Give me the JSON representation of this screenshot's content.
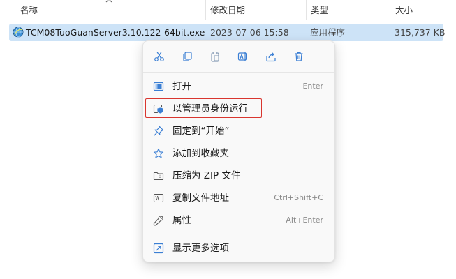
{
  "columns": {
    "name": "名称",
    "modified": "修改日期",
    "type": "类型",
    "size": "大小"
  },
  "file": {
    "name": "TCM08TuoGuanServer3.10.122-64bit.exe",
    "modified": "2023-07-06 15:58",
    "type": "应用程序",
    "size": "315,737 KB",
    "icon": "app-globe-icon"
  },
  "quick_actions": [
    {
      "icon": "cut-icon"
    },
    {
      "icon": "copy-icon"
    },
    {
      "icon": "paste-icon"
    },
    {
      "icon": "rename-icon"
    },
    {
      "icon": "share-icon"
    },
    {
      "icon": "delete-icon"
    }
  ],
  "menu": {
    "open": {
      "label": "打开",
      "shortcut": "Enter",
      "icon": "open-window-icon"
    },
    "run_as_admin": {
      "label": "以管理员身份运行",
      "icon": "shield-admin-icon"
    },
    "pin_start": {
      "label": "固定到“开始”",
      "icon": "pin-icon"
    },
    "add_favorites": {
      "label": "添加到收藏夹",
      "icon": "star-icon"
    },
    "compress_zip": {
      "label": "压缩为 ZIP 文件",
      "icon": "zip-folder-icon"
    },
    "copy_path": {
      "label": "复制文件地址",
      "shortcut": "Ctrl+Shift+C",
      "icon": "copy-path-icon"
    },
    "properties": {
      "label": "属性",
      "shortcut": "Alt+Enter",
      "icon": "wrench-icon"
    },
    "more_options": {
      "label": "显示更多选项",
      "icon": "more-options-icon"
    }
  },
  "colors": {
    "selection": "#cde3f7",
    "menu_bg": "#f9f9f9",
    "icon_blue": "#3b7fd4",
    "highlight_red": "#d9362f"
  }
}
